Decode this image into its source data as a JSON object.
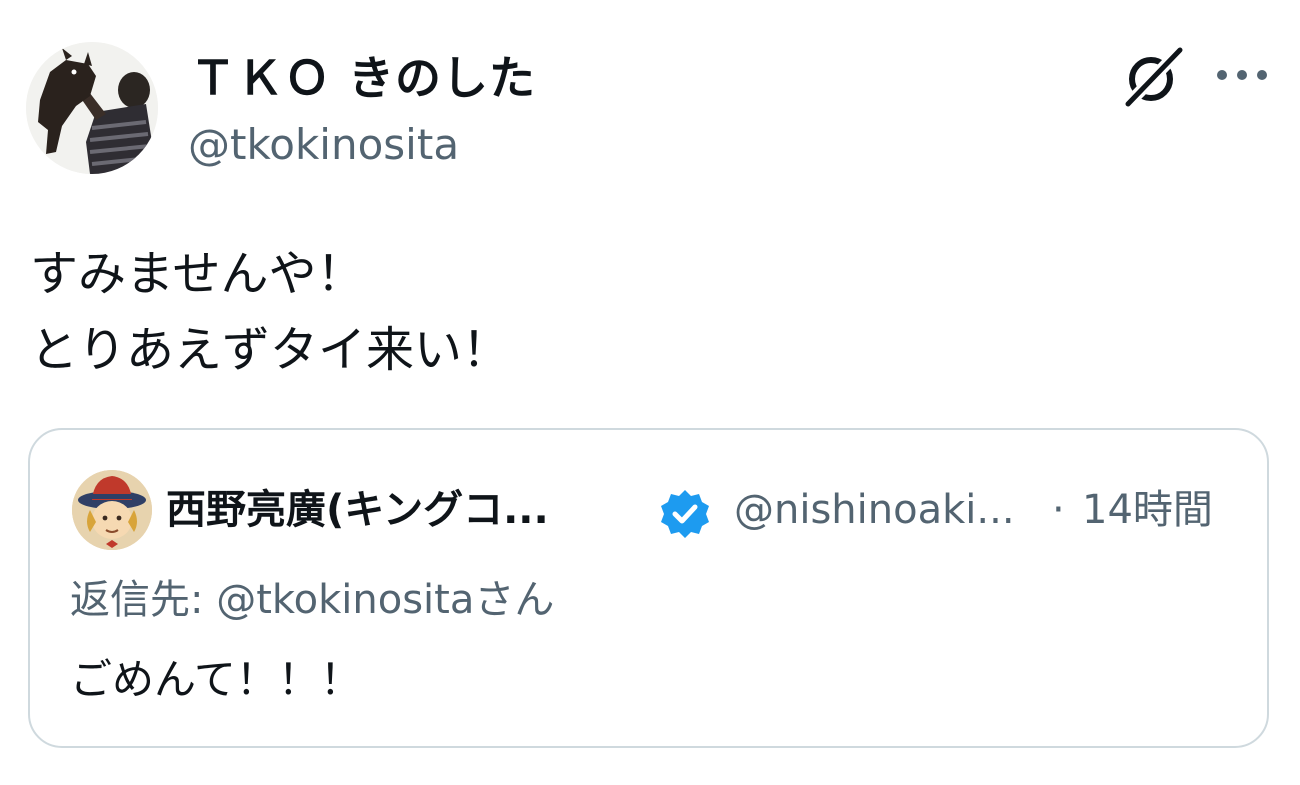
{
  "post": {
    "display_name": "ＴＫＯ きのした",
    "handle": "@tkokinosita",
    "text_lines": [
      "すみませんや！",
      "とりあえずタイ来い！"
    ],
    "icons": {
      "grok": "grok-icon",
      "more": "more-options-icon"
    }
  },
  "quoted_post": {
    "display_name": "西野亮廣(キングコ...",
    "verified": true,
    "verified_color": "#1d9bf0",
    "handle": "@nishinoaki...",
    "separator": "·",
    "time": "14時間",
    "reply_prefix": "返信先: ",
    "reply_handle": "@tkokinosita",
    "reply_suffix": "さん",
    "text": "ごめんて！！！"
  },
  "colors": {
    "text_primary": "#0f1419",
    "text_secondary": "#536471",
    "border": "#cfd9de"
  }
}
